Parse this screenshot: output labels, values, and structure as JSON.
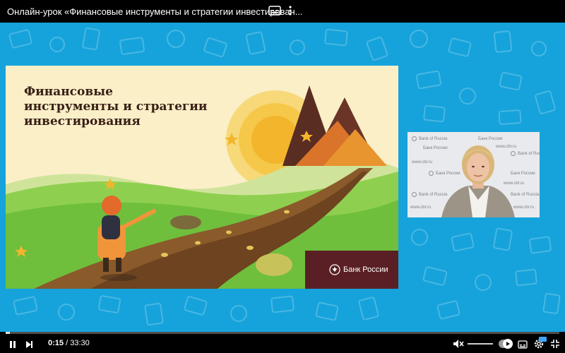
{
  "player": {
    "title": "Онлайн-урок «Финансовые инструменты и стратегии инвестирован...",
    "current_time": "0:15",
    "separator": " / ",
    "duration": "33:30",
    "progress_fraction": 0.0075
  },
  "slide": {
    "title_line1": "Финансовые",
    "title_line2": "инструменты и стратегии",
    "title_line3": "инвестирования",
    "bank_name": "Банк России"
  },
  "webcam": {
    "watermark_en": "Bank of Russia",
    "watermark_ru": "Банк России",
    "watermark_url": "www.cbr.ru"
  },
  "icons": [
    "captions-icon",
    "more-vert-icon",
    "play-pause-icon",
    "next-icon",
    "mute-icon",
    "subtitles-icon",
    "settings-icon",
    "fullscreen-exit-icon"
  ],
  "colors": {
    "background_blue": "#16a3db",
    "slide_cream": "#fbefc8",
    "bank_maroon": "#5a1f24",
    "grass_green": "#79c443",
    "controls_black": "#000000"
  }
}
